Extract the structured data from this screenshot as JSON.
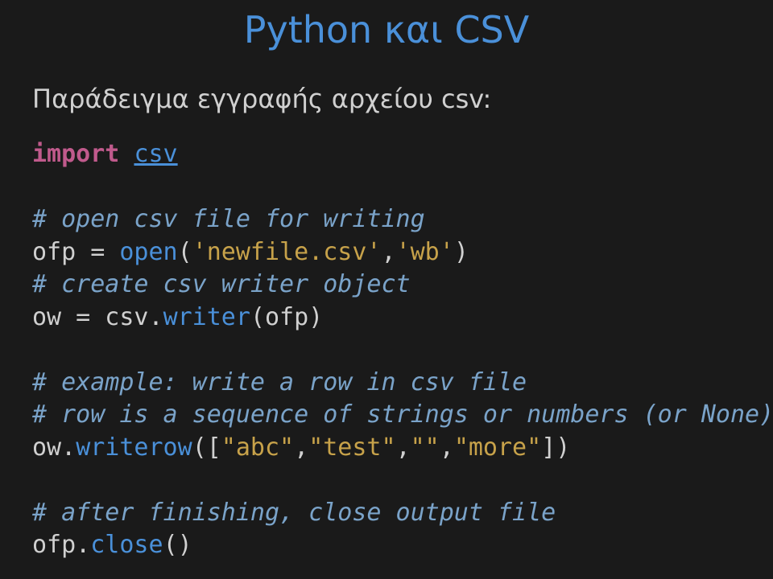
{
  "title": "Python και CSV",
  "subtitle": "Παράδειγμα εγγραφής αρχείου csv:",
  "code": {
    "l1_import": "import",
    "l1_csv": "csv",
    "l3_comment": "# open csv file for writing",
    "l4_a": "ofp = ",
    "l4_open": "open",
    "l4_p1": "(",
    "l4_s1": "'newfile.csv'",
    "l4_c": ",",
    "l4_s2": "'wb'",
    "l4_p2": ")",
    "l5_comment": "# create csv writer object",
    "l6_a": "ow = csv.",
    "l6_writer": "writer",
    "l6_p1": "(ofp)",
    "l8_comment": "# example: write a row in csv file",
    "l9_comment": "# row is a sequence of strings or numbers (or None)",
    "l10_a": "ow.",
    "l10_wr": "writerow",
    "l10_p1": "([",
    "l10_s1": "\"abc\"",
    "l10_c1": ",",
    "l10_s2": "\"test\"",
    "l10_c2": ",",
    "l10_s3": "\"\"",
    "l10_c3": ",",
    "l10_s4": "\"more\"",
    "l10_p2": "])",
    "l12_comment": "# after finishing, close output file",
    "l13_a": "ofp.",
    "l13_close": "close",
    "l13_p": "()"
  }
}
